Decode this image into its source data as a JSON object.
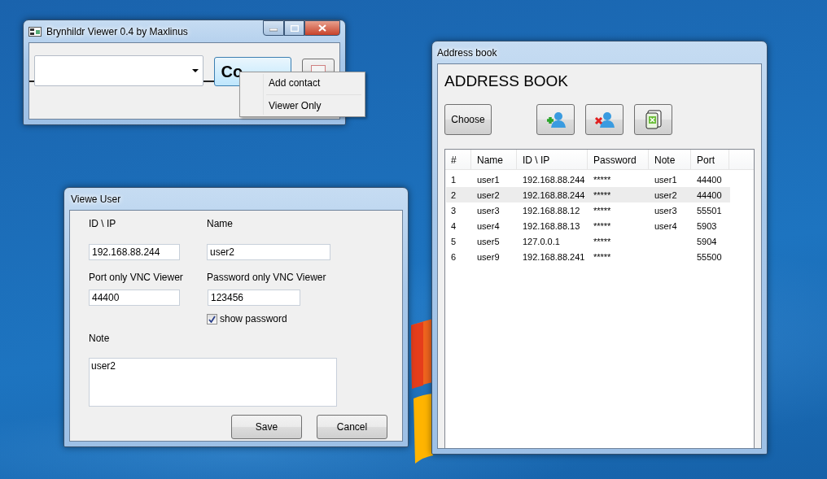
{
  "main_window": {
    "title": "Brynhildr Viewer 0.4 by Maxlinus",
    "connect_button": "Co",
    "context_menu": [
      {
        "label": "Add contact"
      },
      {
        "label": "Viewer Only"
      }
    ]
  },
  "user_window": {
    "title": "Viewe User",
    "fields": [
      {
        "label": "ID \\ IP",
        "value": "192.168.88.244"
      },
      {
        "label": "Name",
        "value": "user2"
      },
      {
        "label": "Port only VNC Viewer",
        "value": "44400"
      },
      {
        "label": "Password only VNC Viewer",
        "value": "123456"
      }
    ],
    "show_password": {
      "label": "show password",
      "checked": true
    },
    "note": {
      "label": "Note",
      "value": "user2"
    },
    "buttons": [
      "Save",
      "Cancel"
    ]
  },
  "address_book": {
    "title": "Address book",
    "heading": "ADDRESS BOOK",
    "toolbar": [
      {
        "kind": "text",
        "label": "Choose"
      },
      {
        "kind": "add"
      },
      {
        "kind": "delete"
      },
      {
        "kind": "excel"
      }
    ],
    "table": {
      "columns": [
        "#",
        "Name",
        "ID \\ IP",
        "Password",
        "Note",
        "Port"
      ],
      "rows": [
        {
          "cells": [
            "1",
            "user1",
            "192.168.88.244",
            "*****",
            "user1",
            "44400"
          ],
          "selected": false
        },
        {
          "cells": [
            "2",
            "user2",
            "192.168.88.244",
            "*****",
            "user2",
            "44400"
          ],
          "selected": true
        },
        {
          "cells": [
            "3",
            "user3",
            "192.168.88.12",
            "*****",
            "user3",
            "55501"
          ],
          "selected": false
        },
        {
          "cells": [
            "4",
            "user4",
            "192.168.88.13",
            "*****",
            "user4",
            "5903"
          ],
          "selected": false
        },
        {
          "cells": [
            "5",
            "user5",
            "127.0.0.1",
            "*****",
            "",
            "5904"
          ],
          "selected": false
        },
        {
          "cells": [
            "6",
            "user9",
            "192.168.88.241",
            "*****",
            "",
            "55500"
          ],
          "selected": false
        }
      ]
    }
  }
}
